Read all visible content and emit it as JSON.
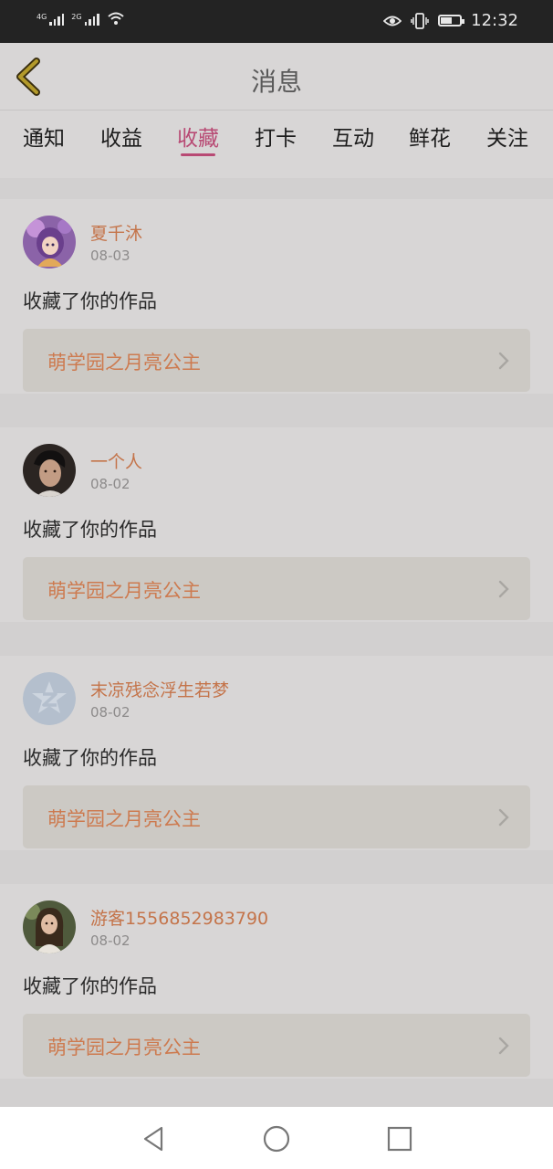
{
  "status_bar": {
    "sim1": "4G",
    "sim2": "2G",
    "time": "12:32",
    "battery_level": 0.55
  },
  "header": {
    "title": "消息"
  },
  "tabs": [
    {
      "label": "通知"
    },
    {
      "label": "收益"
    },
    {
      "label": "收藏",
      "active": true
    },
    {
      "label": "打卡"
    },
    {
      "label": "互动"
    },
    {
      "label": "鲜花"
    },
    {
      "label": "关注"
    }
  ],
  "messages": [
    {
      "username": "夏千沐",
      "date": "08-03",
      "action": "收藏了你的作品",
      "work_title": "萌学园之月亮公主",
      "avatar": "anime-girl-avatar"
    },
    {
      "username": "一个人",
      "date": "08-02",
      "action": "收藏了你的作品",
      "work_title": "萌学园之月亮公主",
      "avatar": "man-photo-avatar"
    },
    {
      "username": "末凉残念浮生若梦",
      "date": "08-02",
      "action": "收藏了你的作品",
      "work_title": "萌学园之月亮公主",
      "avatar": "default-star-avatar"
    },
    {
      "username": "游客1556852983790",
      "date": "08-02",
      "action": "收藏了你的作品",
      "work_title": "萌学园之月亮公主",
      "avatar": "girl-photo-avatar"
    }
  ],
  "colors": {
    "accent": "#b84a74",
    "username": "#c4744a",
    "work_title": "#cd7a4f"
  },
  "icons": {
    "back": "back-chevron-icon",
    "nav_back": "triangle-back-icon",
    "nav_home": "circle-home-icon",
    "nav_recents": "square-recents-icon"
  }
}
